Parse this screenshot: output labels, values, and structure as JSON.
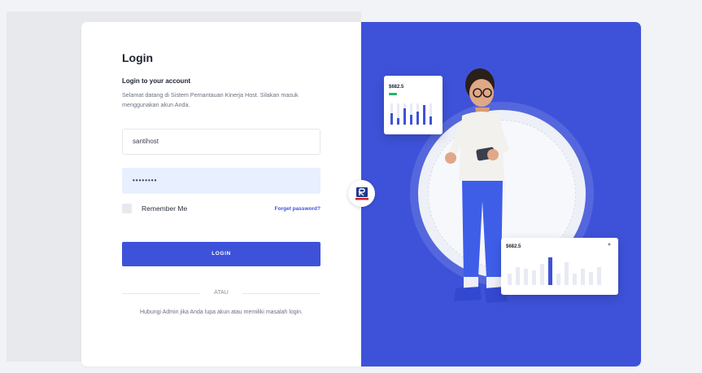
{
  "login": {
    "title": "Login",
    "subtitle": "Login to your account",
    "description": "Selamat datang di Sistem Pemantauan Kinerja Host. Silakan masuk menggunakan akun Anda.",
    "username_value": "santihost",
    "password_value": "••••••••",
    "remember_label": "Remember Me",
    "forgot_label": "Forget password?",
    "login_button": "LOGIN",
    "divider_text": "ATAU",
    "help_text": "Hubungi Admin jika Anda lupa akun atau memiliki masalah login."
  },
  "illustration": {
    "card_one_value": "$682.5",
    "card_two_value": "$682.5"
  },
  "colors": {
    "accent": "#3e52d9",
    "password_bg": "#e8efff"
  },
  "icons": {
    "logo": "brand-logo-icon"
  }
}
